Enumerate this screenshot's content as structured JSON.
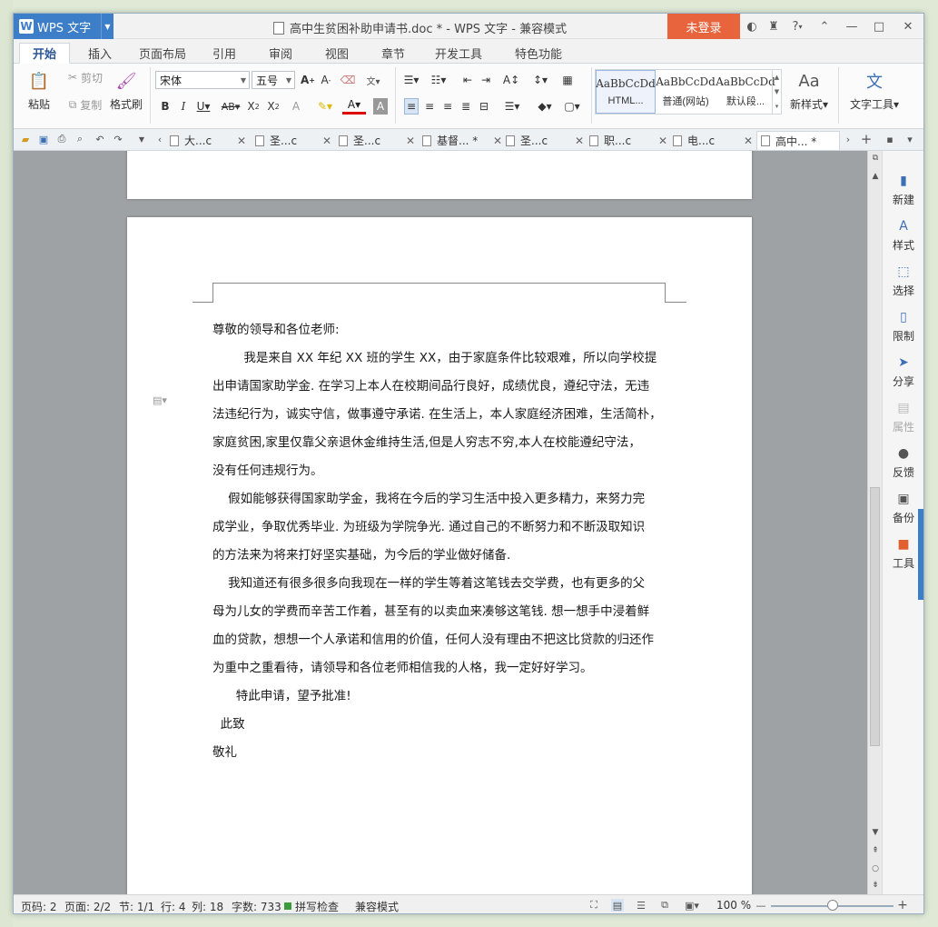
{
  "title_bar": {
    "app_label": "WPS 文字",
    "document_title": "高中生贫困补助申请书.doc * - WPS 文字 - 兼容模式",
    "login_label": "未登录",
    "help_label": "?"
  },
  "ribbon_tabs": [
    "开始",
    "插入",
    "页面布局",
    "引用",
    "审阅",
    "视图",
    "章节",
    "开发工具",
    "特色功能"
  ],
  "ribbon": {
    "paste": "粘贴",
    "cut": "剪切",
    "copy": "复制",
    "format_painter": "格式刷",
    "font_name": "宋体",
    "font_size": "五号",
    "styles": [
      {
        "preview": "AaBbCcDd",
        "caption": "HTML..."
      },
      {
        "preview": "AaBbCcDd",
        "caption": "普通(网站)"
      },
      {
        "preview": "AaBbCcDd",
        "caption": "默认段..."
      }
    ],
    "new_style": "新样式",
    "text_tools": "文字工具"
  },
  "doc_tabs": [
    "大...c",
    "圣...c",
    "圣...c",
    "基督... *",
    "圣...c",
    "职...c",
    "电...c",
    "高中... *"
  ],
  "document": {
    "salutation": "尊敬的领导和各位老师:",
    "lines": [
      "        我是来自 XX 年纪 XX 班的学生 XX，由于家庭条件比较艰难，所以向学校提",
      "出申请国家助学金. 在学习上本人在校期间品行良好，成绩优良，遵纪守法，无违",
      "法违纪行为，诚实守信，做事遵守承诺. 在生活上，本人家庭经济困难，生活简朴，",
      "家庭贫困,家里仅靠父亲退休金维持生活,但是人穷志不穷,本人在校能遵纪守法，",
      "没有任何违规行为。",
      "    假如能够获得国家助学金，我将在今后的学习生活中投入更多精力，来努力完",
      "成学业，争取优秀毕业. 为班级为学院争光. 通过自己的不断努力和不断汲取知识",
      "的方法来为将来打好坚实基础，为今后的学业做好储备.",
      "    我知道还有很多很多向我现在一样的学生等着这笔钱去交学费，也有更多的父",
      "母为儿女的学费而辛苦工作着，甚至有的以卖血来凑够这笔钱. 想一想手中浸着鲜",
      "血的贷款，想想一个人承诺和信用的价值，任何人没有理由不把这比贷款的归还作",
      "为重中之重看待，请领导和各位老师相信我的人格，我一定好好学习。",
      "      特此申请，望予批准!",
      "  此致",
      "敬礼"
    ]
  },
  "sidebar": [
    "新建",
    "样式",
    "选择",
    "限制",
    "分享",
    "属性",
    "反馈",
    "备份",
    "工具"
  ],
  "status": {
    "page_code": "页码: 2",
    "pages": "页面: 2/2",
    "section": "节: 1/1",
    "row": "行: 4",
    "col": "列: 18",
    "words": "字数: 733",
    "spell": "拼写检查",
    "mode": "兼容模式",
    "zoom": "100 %"
  }
}
